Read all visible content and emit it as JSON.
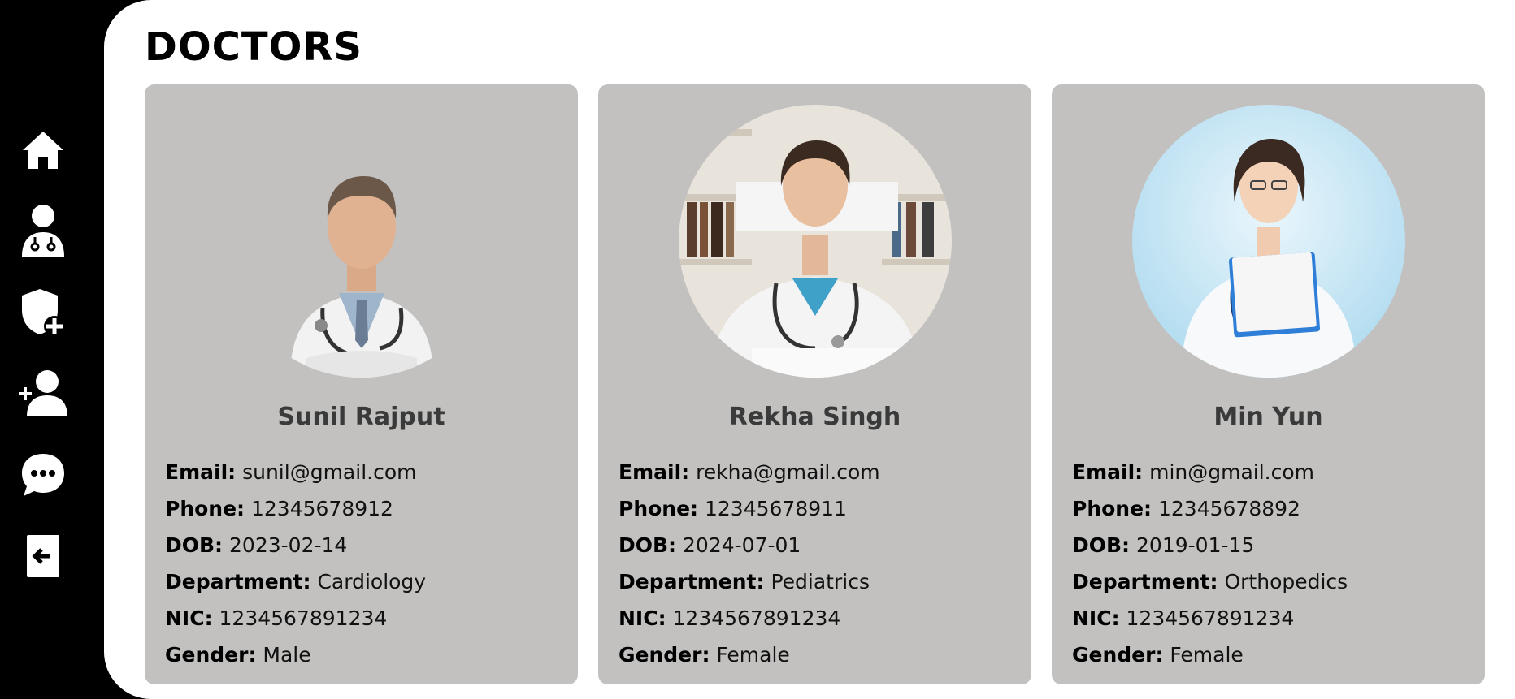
{
  "page": {
    "title": "DOCTORS"
  },
  "sidebar": {
    "items": [
      {
        "icon": "home-icon"
      },
      {
        "icon": "doctor-icon"
      },
      {
        "icon": "shield-plus-icon"
      },
      {
        "icon": "add-user-icon"
      },
      {
        "icon": "chat-icon"
      },
      {
        "icon": "logout-icon"
      }
    ]
  },
  "labels": {
    "email": "Email:",
    "phone": "Phone:",
    "dob": "DOB:",
    "department": "Department:",
    "nic": "NIC:",
    "gender": "Gender:"
  },
  "doctors": [
    {
      "name": "Sunil Rajput",
      "email": "sunil@gmail.com",
      "phone": "12345678912",
      "dob": "2023-02-14",
      "department": "Cardiology",
      "nic": "1234567891234",
      "gender": "Male"
    },
    {
      "name": "Rekha Singh",
      "email": "rekha@gmail.com",
      "phone": "12345678911",
      "dob": "2024-07-01",
      "department": "Pediatrics",
      "nic": "1234567891234",
      "gender": "Female"
    },
    {
      "name": "Min Yun",
      "email": "min@gmail.com",
      "phone": "12345678892",
      "dob": "2019-01-15",
      "department": "Orthopedics",
      "nic": "1234567891234",
      "gender": "Female"
    }
  ],
  "colors": {
    "sidebar_bg": "#000000",
    "main_bg": "#ffffff",
    "card_bg": "#c2c1c0",
    "name_color": "#3a3a3a"
  }
}
